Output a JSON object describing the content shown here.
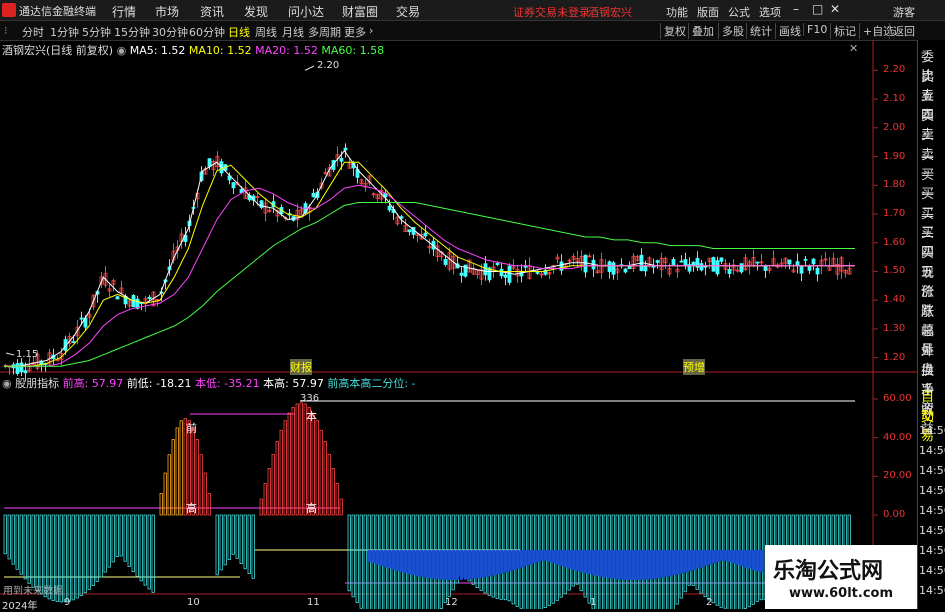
{
  "menubar": {
    "app_title": "通达信金融终端",
    "items": [
      "行情",
      "市场",
      "资讯",
      "发现",
      "问小达",
      "财富圈",
      "交易"
    ],
    "login_status": "证券交易未登录",
    "stock_name": "酒钢宏兴",
    "right_items": [
      "功能",
      "版面",
      "公式",
      "选项"
    ],
    "guest": "游客"
  },
  "toolbar": {
    "periods": [
      "分时",
      "1分钟",
      "5分钟",
      "15分钟",
      "30分钟",
      "60分钟",
      "日线",
      "周线",
      "月线",
      "多周期",
      "更多"
    ],
    "active_period": "日线",
    "right_buttons": [
      "复权",
      "叠加",
      "多股",
      "统计",
      "画线",
      "F10",
      "标记",
      "+自选",
      "返回"
    ]
  },
  "main_chart": {
    "title": "酒钢宏兴(日线 前复权)",
    "ma": [
      {
        "label": "MA5: 1.52",
        "color": "#ffffff"
      },
      {
        "label": "MA10: 1.52",
        "color": "#ffff00"
      },
      {
        "label": "MA20: 1.52",
        "color": "#ff44ff"
      },
      {
        "label": "MA60: 1.58",
        "color": "#44ff44"
      }
    ],
    "high_label": "2.20",
    "low_label": "1.15",
    "y_ticks": [
      "2.20",
      "2.10",
      "2.00",
      "1.90",
      "1.80",
      "1.70",
      "1.60",
      "1.50",
      "1.40",
      "1.30",
      "1.20"
    ],
    "event_labels": [
      "财报",
      "预增"
    ]
  },
  "indicator": {
    "name": "股朋指标",
    "values": [
      {
        "label": "前高: 57.97",
        "color": "#ff44ff"
      },
      {
        "label": "前低: -18.21",
        "color": "#ffffff"
      },
      {
        "label": "本低: -35.21",
        "color": "#ff44ff"
      },
      {
        "label": "本高: 57.97",
        "color": "#ffffff"
      },
      {
        "label": "前高本高二分位: -",
        "color": "#44dddd"
      }
    ],
    "peak_value": "336",
    "annotations": [
      "前",
      "高",
      "本",
      "高"
    ],
    "y_ticks": [
      "60.00",
      "40.00",
      "20.00",
      "0.00"
    ],
    "footer_note": "用到未来数据"
  },
  "x_axis": {
    "labels": [
      "2024年",
      "9",
      "10",
      "11",
      "12",
      "1",
      "2"
    ]
  },
  "right_panel": {
    "items": [
      "委比",
      "卖五",
      "卖四",
      "卖三",
      "卖二",
      "卖一",
      "买一",
      "买二",
      "买三",
      "买四",
      "买五",
      "现价",
      "涨跌",
      "涨幅",
      "总量",
      "外盘",
      "换手",
      "净资",
      "收益",
      "自动",
      "交易"
    ],
    "times": [
      "14:56",
      "14:56",
      "14:56",
      "14:56",
      "14:56",
      "14:56",
      "14:56",
      "14:56",
      "14:56"
    ]
  },
  "watermark": {
    "title": "乐淘公式网",
    "url": "www.60lt.com"
  },
  "chart_data": {
    "type": "line",
    "title": "酒钢宏兴(日线 前复权)",
    "x": [
      0,
      4,
      8,
      12,
      16,
      20,
      24,
      28,
      32,
      36,
      40,
      44,
      48,
      52,
      56,
      60,
      64,
      68,
      72,
      76,
      80,
      84,
      88,
      92,
      96,
      100,
      104,
      108,
      112,
      116,
      120,
      124,
      128,
      132,
      136,
      140,
      144,
      148,
      152,
      156,
      160,
      164,
      168,
      172,
      176,
      180,
      184,
      188,
      192,
      196,
      200,
      204,
      208,
      212,
      216,
      220,
      224,
      228,
      232,
      236,
      240
    ],
    "series": [
      {
        "name": "MA5",
        "values": [
          1.17,
          1.17,
          1.18,
          1.19,
          1.22,
          1.28,
          1.36,
          1.48,
          1.43,
          1.4,
          1.39,
          1.42,
          1.55,
          1.65,
          1.85,
          1.88,
          1.83,
          1.78,
          1.73,
          1.72,
          1.68,
          1.69,
          1.76,
          1.86,
          1.92,
          1.85,
          1.8,
          1.75,
          1.68,
          1.64,
          1.6,
          1.56,
          1.52,
          1.51,
          1.5,
          1.5,
          1.49,
          1.5,
          1.51,
          1.52,
          1.53,
          1.53,
          1.52,
          1.52,
          1.52,
          1.53,
          1.52,
          1.52,
          1.52,
          1.52,
          1.52,
          1.52,
          1.52,
          1.52,
          1.52,
          1.52,
          1.52,
          1.52,
          1.52,
          1.52,
          1.52
        ]
      },
      {
        "name": "MA10",
        "values": [
          1.17,
          1.17,
          1.17,
          1.18,
          1.2,
          1.25,
          1.31,
          1.4,
          1.42,
          1.4,
          1.39,
          1.4,
          1.48,
          1.58,
          1.73,
          1.85,
          1.87,
          1.82,
          1.77,
          1.73,
          1.7,
          1.69,
          1.72,
          1.8,
          1.88,
          1.88,
          1.83,
          1.78,
          1.72,
          1.67,
          1.63,
          1.59,
          1.55,
          1.53,
          1.51,
          1.5,
          1.5,
          1.5,
          1.5,
          1.51,
          1.52,
          1.52,
          1.52,
          1.52,
          1.52,
          1.52,
          1.52,
          1.52,
          1.52,
          1.52,
          1.52,
          1.52,
          1.52,
          1.52,
          1.52,
          1.52,
          1.52,
          1.52,
          1.52,
          1.52,
          1.52
        ]
      },
      {
        "name": "MA20",
        "values": [
          1.17,
          1.17,
          1.17,
          1.17,
          1.18,
          1.21,
          1.25,
          1.31,
          1.35,
          1.37,
          1.38,
          1.39,
          1.42,
          1.48,
          1.58,
          1.68,
          1.75,
          1.78,
          1.79,
          1.77,
          1.74,
          1.72,
          1.72,
          1.75,
          1.79,
          1.8,
          1.79,
          1.77,
          1.73,
          1.69,
          1.65,
          1.61,
          1.58,
          1.56,
          1.54,
          1.53,
          1.52,
          1.52,
          1.51,
          1.51,
          1.51,
          1.52,
          1.52,
          1.52,
          1.52,
          1.52,
          1.52,
          1.52,
          1.52,
          1.52,
          1.52,
          1.52,
          1.52,
          1.52,
          1.52,
          1.52,
          1.52,
          1.52,
          1.52,
          1.52,
          1.52
        ]
      },
      {
        "name": "MA60",
        "values": [
          1.17,
          1.17,
          1.17,
          1.17,
          1.17,
          1.18,
          1.19,
          1.21,
          1.23,
          1.25,
          1.27,
          1.29,
          1.31,
          1.34,
          1.38,
          1.43,
          1.47,
          1.51,
          1.55,
          1.59,
          1.62,
          1.65,
          1.67,
          1.7,
          1.73,
          1.74,
          1.74,
          1.74,
          1.74,
          1.74,
          1.73,
          1.72,
          1.71,
          1.7,
          1.69,
          1.68,
          1.67,
          1.66,
          1.65,
          1.64,
          1.63,
          1.62,
          1.62,
          1.61,
          1.61,
          1.6,
          1.6,
          1.59,
          1.59,
          1.59,
          1.58,
          1.58,
          1.58,
          1.58,
          1.58,
          1.58,
          1.58,
          1.58,
          1.58,
          1.58,
          1.58
        ]
      }
    ],
    "ylim": [
      1.15,
      2.25
    ]
  }
}
